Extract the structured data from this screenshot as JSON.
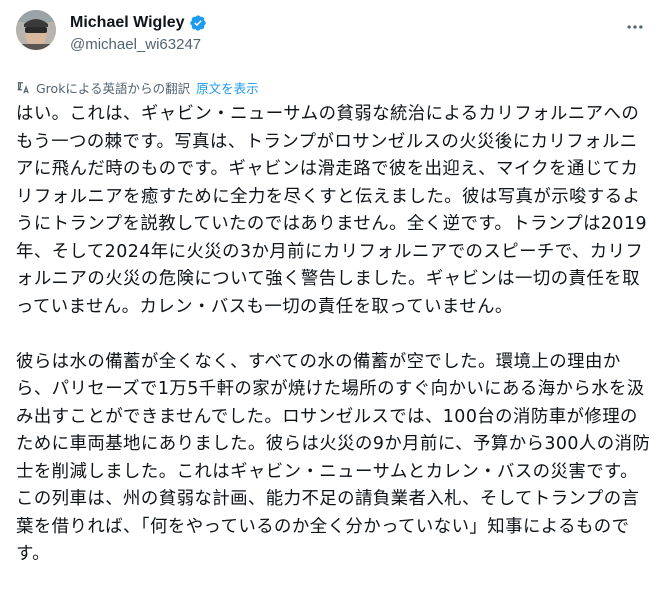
{
  "author": {
    "display_name": "Michael Wigley",
    "handle": "@michael_wi63247",
    "verified": true
  },
  "translation": {
    "note": "Grokによる英語からの翻訳",
    "show_original_label": "原文を表示"
  },
  "body": {
    "paragraphs": [
      "はい。これは、ギャビン・ニューサムの貧弱な統治によるカリフォルニアへのもう一つの棘です。写真は、トランプがロサンゼルスの火災後にカリフォルニアに飛んだ時のものです。ギャビンは滑走路で彼を出迎え、マイクを通じてカリフォルニアを癒すために全力を尽くすと伝えました。彼は写真が示唆するようにトランプを説教していたのではありません。全く逆です。トランプは2019年、そして2024年に火災の3か月前にカリフォルニアでのスピーチで、カリフォルニアの火災の危険について強く警告しました。ギャビンは一切の責任を取っていません。カレン・バスも一切の責任を取っていません。",
      "彼らは水の備蓄が全くなく、すべての水の備蓄が空でした。環境上の理由から、パリセーズで1万5千軒の家が焼けた場所のすぐ向かいにある海から水を汲み出すことができませんでした。ロサンゼルスでは、100台の消防車が修理のために車両基地にありました。彼らは火災の9か月前に、予算から300人の消防士を削減しました。これはギャビン・ニューサムとカレン・バスの災害です。この列車は、州の貧弱な計画、能力不足の請負業者入札、そしてトランプの言葉を借りれば、「何をやっているのか全く分かっていない」知事によるものです。"
    ]
  },
  "icons": {
    "verified": "verified-badge-icon",
    "more": "more-options-icon",
    "translate": "translate-icon"
  },
  "colors": {
    "text": "#0f1419",
    "secondary": "#536471",
    "accent": "#1d9bf0"
  }
}
